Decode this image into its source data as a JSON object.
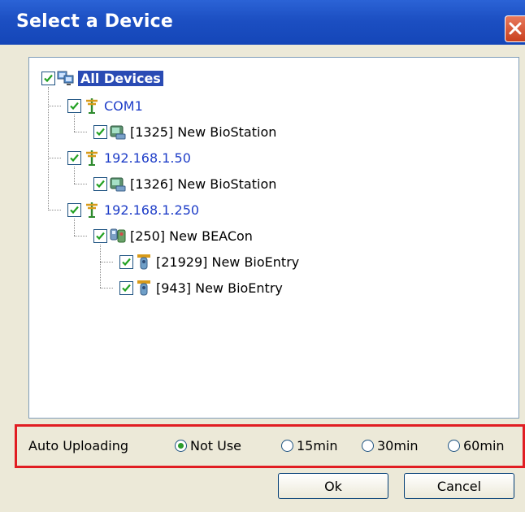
{
  "window": {
    "title": "Select a Device"
  },
  "tree": {
    "root": {
      "label": "All Devices",
      "icon": "computer-icon",
      "checked": true
    },
    "items": [
      {
        "label": "COM1",
        "icon": "antenna-icon",
        "checked": true,
        "color": "#1f3ec8"
      },
      {
        "label": "[1325] New BioStation",
        "icon": "biostation-icon",
        "checked": true
      },
      {
        "label": "192.168.1.50",
        "icon": "antenna-icon",
        "checked": true,
        "color": "#1f3ec8"
      },
      {
        "label": "[1326] New BioStation",
        "icon": "biostation-icon",
        "checked": true
      },
      {
        "label": "192.168.1.250",
        "icon": "antenna-icon",
        "checked": true,
        "color": "#1f3ec8"
      },
      {
        "label": "[250] New BEACon",
        "icon": "beacon-icon",
        "checked": true
      },
      {
        "label": "[21929] New BioEntry",
        "icon": "bioentry-icon",
        "checked": true
      },
      {
        "label": "[943] New BioEntry",
        "icon": "bioentry-icon",
        "checked": true
      }
    ]
  },
  "auto_upload": {
    "label": "Auto Uploading",
    "options": [
      "Not Use",
      "15min",
      "30min",
      "60min"
    ],
    "selected": "Not Use"
  },
  "buttons": {
    "ok": "Ok",
    "cancel": "Cancel"
  },
  "colors": {
    "highlight": "#e11d22",
    "title_bar": "#1c4fc2",
    "link_blue": "#1f3ec8"
  }
}
